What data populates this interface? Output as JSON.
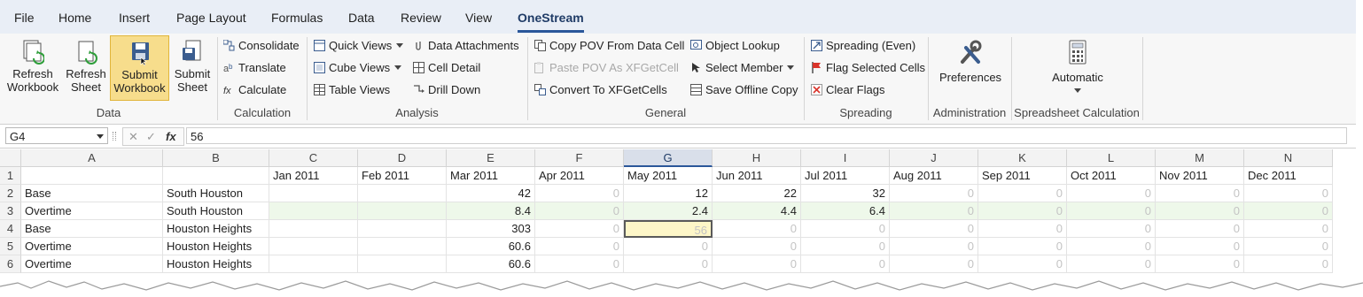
{
  "menu": [
    "File",
    "Home",
    "Insert",
    "Page Layout",
    "Formulas",
    "Data",
    "Review",
    "View",
    "OneStream"
  ],
  "ribbon": {
    "data_group": {
      "label": "Data",
      "buttons": [
        {
          "l1": "Refresh",
          "l2": "Workbook"
        },
        {
          "l1": "Refresh",
          "l2": "Sheet"
        },
        {
          "l1": "Submit",
          "l2": "Workbook"
        },
        {
          "l1": "Submit",
          "l2": "Sheet"
        }
      ]
    },
    "calculation_group": {
      "label": "Calculation",
      "items": [
        "Consolidate",
        "Translate",
        "Calculate"
      ]
    },
    "analysis_group": {
      "label": "Analysis",
      "items": [
        "Quick Views",
        "Cube Views",
        "Table Views",
        "Data Attachments",
        "Cell Detail",
        "Drill Down"
      ]
    },
    "general_group": {
      "label": "General",
      "items": [
        "Copy POV From Data Cell",
        "Paste POV As XFGetCell",
        "Convert To XFGetCells",
        "Object Lookup",
        "Select Member",
        "Save Offline Copy"
      ]
    },
    "spreading_group": {
      "label": "Spreading",
      "items": [
        "Spreading (Even)",
        "Flag Selected Cells",
        "Clear Flags"
      ]
    },
    "administration_group": {
      "label": "Administration",
      "button": "Preferences"
    },
    "calc_mode_group": {
      "label": "Spreadsheet Calculation",
      "button": "Automatic"
    }
  },
  "formula_bar": {
    "cell_ref": "G4",
    "value": "56",
    "fx": "fx"
  },
  "columns": [
    "A",
    "B",
    "C",
    "D",
    "E",
    "F",
    "G",
    "H",
    "I",
    "J",
    "K",
    "L",
    "M",
    "N"
  ],
  "rows": [
    {
      "n": "1",
      "cells": [
        "",
        "",
        "Jan 2011",
        "Feb 2011",
        "Mar 2011",
        "Apr 2011",
        "May 2011",
        "Jun 2011",
        "Jul 2011",
        "Aug 2011",
        "Sep 2011",
        "Oct 2011",
        "Nov 2011",
        "Dec 2011"
      ]
    },
    {
      "n": "2",
      "cells": [
        "Base",
        "South Houston",
        "",
        "",
        "42",
        "0",
        "12",
        "22",
        "32",
        "0",
        "0",
        "0",
        "0",
        "0"
      ]
    },
    {
      "n": "3",
      "cells": [
        "Overtime",
        "South Houston",
        "",
        "",
        "8.4",
        "0",
        "2.4",
        "4.4",
        "6.4",
        "0",
        "0",
        "0",
        "0",
        "0"
      ]
    },
    {
      "n": "4",
      "cells": [
        "Base",
        "Houston Heights",
        "",
        "",
        "303",
        "0",
        "56",
        "0",
        "0",
        "0",
        "0",
        "0",
        "0",
        "0"
      ]
    },
    {
      "n": "5",
      "cells": [
        "Overtime",
        "Houston Heights",
        "",
        "",
        "60.6",
        "0",
        "0",
        "0",
        "0",
        "0",
        "0",
        "0",
        "0",
        "0"
      ]
    },
    {
      "n": "6",
      "cells": [
        "Overtime",
        "Houston Heights",
        "",
        "",
        "60.6",
        "0",
        "0",
        "0",
        "0",
        "0",
        "0",
        "0",
        "0",
        "0"
      ]
    }
  ],
  "colors": {
    "accent": "#2b579a",
    "active_button": "#f7dd8c",
    "input_row": "#eef8ea",
    "selected_cell": "#fdf6c8"
  }
}
